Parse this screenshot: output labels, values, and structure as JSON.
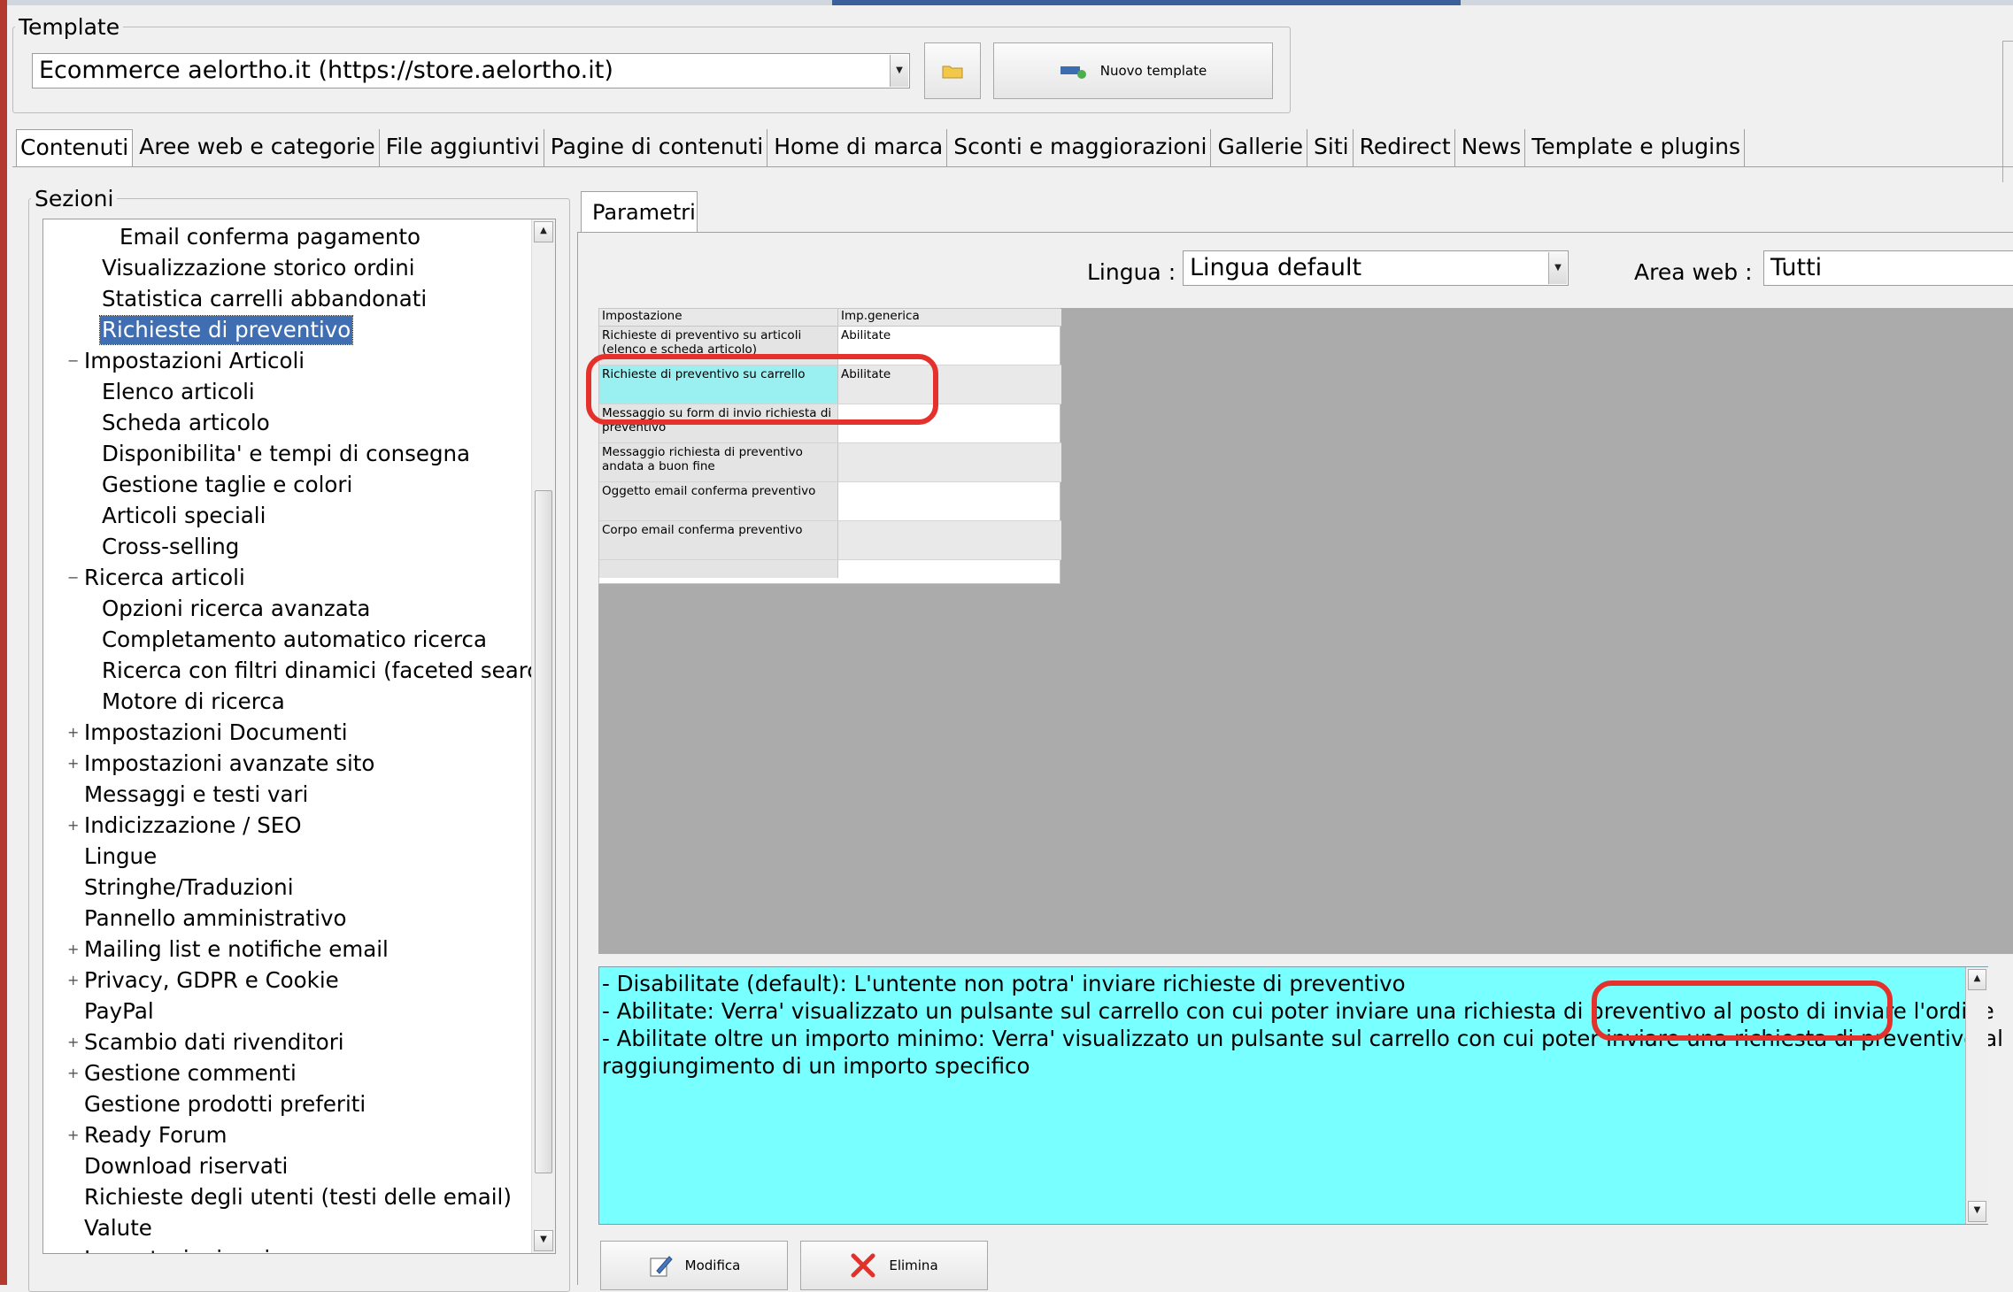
{
  "template_group": {
    "legend": "Template",
    "selected": "Ecommerce aelortho.it (https://store.aelortho.it)",
    "new_button": "Nuovo template"
  },
  "tabs": [
    "Contenuti",
    "Aree web e categorie",
    "File aggiuntivi",
    "Pagine di contenuti",
    "Home di marca",
    "Sconti e maggiorazioni",
    "Gallerie",
    "Siti",
    "Redirect",
    "News",
    "Template e plugins"
  ],
  "sections": {
    "legend": "Sezioni",
    "items": [
      "Email conferma pagamento",
      "Visualizzazione storico ordini",
      "Statistica carrelli abbandonati",
      "Richieste di preventivo",
      "Impostazioni Articoli",
      "Elenco articoli",
      "Scheda articolo",
      "Disponibilita' e tempi di consegna",
      "Gestione taglie e colori",
      "Articoli speciali",
      "Cross-selling",
      "Ricerca articoli",
      "Opzioni ricerca avanzata",
      "Completamento automatico ricerca",
      "Ricerca con filtri dinamici (faceted search)",
      "Motore di ricerca",
      "Impostazioni Documenti",
      "Impostazioni avanzate sito",
      "Messaggi e testi vari",
      "Indicizzazione / SEO",
      "Lingue",
      "Stringhe/Traduzioni",
      "Pannello amministrativo",
      "Mailing list e notifiche email",
      "Privacy, GDPR e Cookie",
      "PayPal",
      "Scambio dati rivenditori",
      "Gestione commenti",
      "Gestione prodotti preferiti",
      "Ready Forum",
      "Download riservati",
      "Richieste degli utenti (testi delle email)",
      "Valute",
      "Impostazioni varie"
    ]
  },
  "params": {
    "tab": "Parametri",
    "lingua_label": "Lingua :",
    "lingua_value": "Lingua default",
    "area_label": "Area web :",
    "area_value": "Tutti"
  },
  "grid": {
    "headers": [
      "Impostazione",
      "Imp.generica"
    ],
    "rows": [
      {
        "name": "Richieste di preventivo su articoli (elenco e scheda articolo)",
        "value": "Abilitate"
      },
      {
        "name": "Richieste di preventivo su carrello",
        "value": "Abilitate"
      },
      {
        "name": "Messaggio su form di invio richiesta di preventivo",
        "value": ""
      },
      {
        "name": "Messaggio richiesta di preventivo andata a buon fine",
        "value": ""
      },
      {
        "name": "Oggetto email conferma preventivo",
        "value": ""
      },
      {
        "name": "Corpo email conferma preventivo",
        "value": ""
      }
    ]
  },
  "description": {
    "lines": [
      "- Disabilitate (default): L'untente non potra' inviare richieste di preventivo",
      "- Abilitate: Verra' visualizzato un pulsante sul carrello con cui poter inviare una richiesta di preventivo al posto di inviare l'ordine",
      "- Abilitate oltre un importo minimo: Verra' visualizzato un pulsante sul carrello con cui poter inviare una richiesta di preventivo al",
      "raggiungimento di un importo specifico"
    ]
  },
  "actions": {
    "edit": "Modifica",
    "delete": "Elimina"
  },
  "colors": {
    "selection": "#3f6eb3",
    "highlight_annotation": "#e4312b",
    "description_bg": "#78ffff",
    "selected_row_bg": "#9af0f0"
  }
}
